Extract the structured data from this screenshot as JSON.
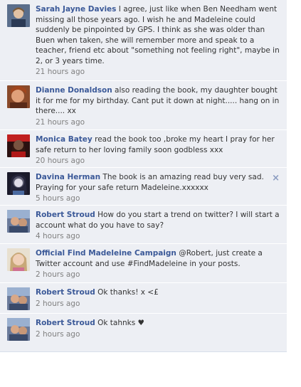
{
  "comments": [
    {
      "author": "Sarah Jayne Davies",
      "text": "I agree, just like when Ben Needham went missing all those years ago. I wish he and Madeleine could suddenly be pinpointed by GPS. I think as she was older than Buen when taken, she will remember more and speak to a teacher, friend etc about \"something not feeling right\", maybe in 2, or 3 years time.",
      "time": "21 hours ago",
      "avatar": "sarah-avatar-icon"
    },
    {
      "author": "Dianne Donaldson",
      "text": "also reading the book, my daughter bought it for me for my birthday. Cant put it down at night..... hang on in there.... xx",
      "time": "21 hours ago",
      "avatar": "dianne-avatar-icon"
    },
    {
      "author": "Monica Batey",
      "text": "read the book too ,broke my heart I pray for her safe return to her loving family soon godbless xxx",
      "time": "20 hours ago",
      "avatar": "monica-avatar-icon"
    },
    {
      "author": "Davina Herman",
      "text": "The book is an amazing read buy very sad. Praying for your safe return Madeleine.xxxxxx",
      "time": "5 hours ago",
      "avatar": "davina-avatar-icon",
      "close": "×"
    },
    {
      "author": "Robert Stroud",
      "text": "How do you start a trend on twitter? I will start a account what do you have to say?",
      "time": "4 hours ago",
      "avatar": "robert-avatar-icon"
    },
    {
      "author": "Official Find Madeleine Campaign",
      "text": "@Robert, just create a Twitter account and use #FindMadeleine in your posts.",
      "time": "2 hours ago",
      "avatar": "madeleine-avatar-icon"
    },
    {
      "author": "Robert Stroud",
      "text": "Ok thanks! x <£",
      "time": "2 hours ago",
      "avatar": "robert-avatar-icon"
    },
    {
      "author": "Robert Stroud",
      "text": "Ok tahnks ♥",
      "time": "2 hours ago",
      "avatar": "robert-avatar-icon"
    }
  ],
  "colors": {
    "feed_bg": "#edeff4",
    "author_link": "#3b5998",
    "timestamp": "#808080"
  }
}
